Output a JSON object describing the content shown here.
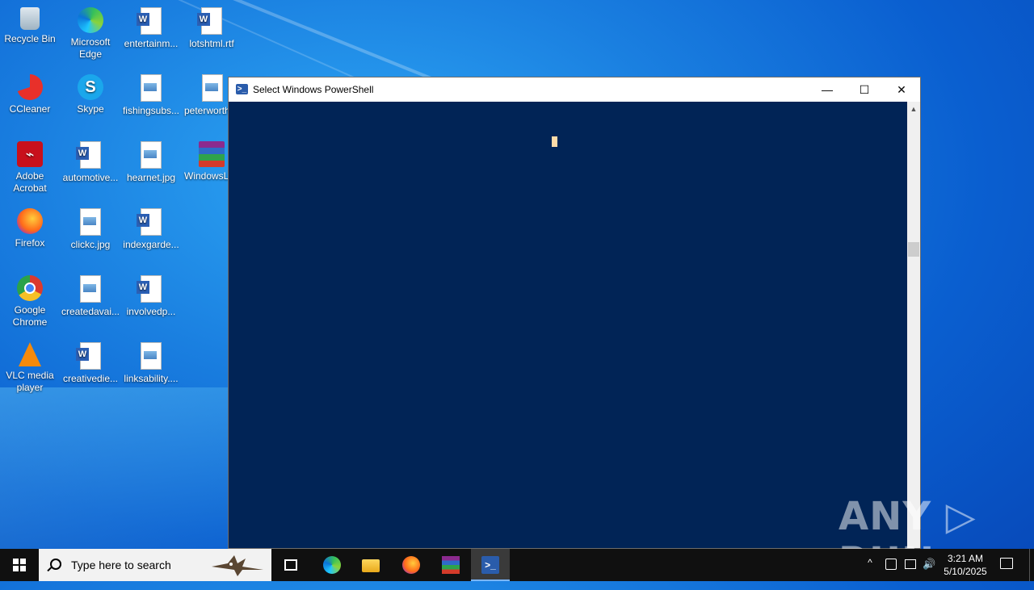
{
  "desktop": {
    "icons": [
      {
        "label": "Recycle Bin"
      },
      {
        "label": "Microsoft Edge"
      },
      {
        "label": "entertainm..."
      },
      {
        "label": "lotshtml.rtf"
      },
      {
        "label": "CCleaner"
      },
      {
        "label": "Skype"
      },
      {
        "label": "fishingsubs..."
      },
      {
        "label": "peterworth"
      },
      {
        "label": "Adobe Acrobat"
      },
      {
        "label": "automotive..."
      },
      {
        "label": "hearnet.jpg"
      },
      {
        "label": "WindowsL"
      },
      {
        "label": "Firefox"
      },
      {
        "label": "clickc.jpg"
      },
      {
        "label": "indexgarde..."
      },
      {
        "label": "Google Chrome"
      },
      {
        "label": "createdavai..."
      },
      {
        "label": "involvedp..."
      },
      {
        "label": "VLC media player"
      },
      {
        "label": "creativedie..."
      },
      {
        "label": "linksability...."
      }
    ]
  },
  "window": {
    "title": "Select Windows PowerShell",
    "minimize_glyph": "—",
    "maximize_glyph": "☐",
    "close_glyph": "✕",
    "console_bg": "#012456",
    "cursor_color": "#fedba9"
  },
  "watermark": {
    "text": "ANY ▷ RUN"
  },
  "taskbar": {
    "search_placeholder": "Type here to search",
    "pinned": [
      "task-view-icon",
      "edge-icon",
      "file-explorer-icon",
      "firefox-icon",
      "winrar-icon",
      "powershell-icon"
    ],
    "clock_time": "3:21 AM",
    "clock_date": "5/10/2025",
    "tray_chevron": "^",
    "tray_volume": "🔊"
  }
}
